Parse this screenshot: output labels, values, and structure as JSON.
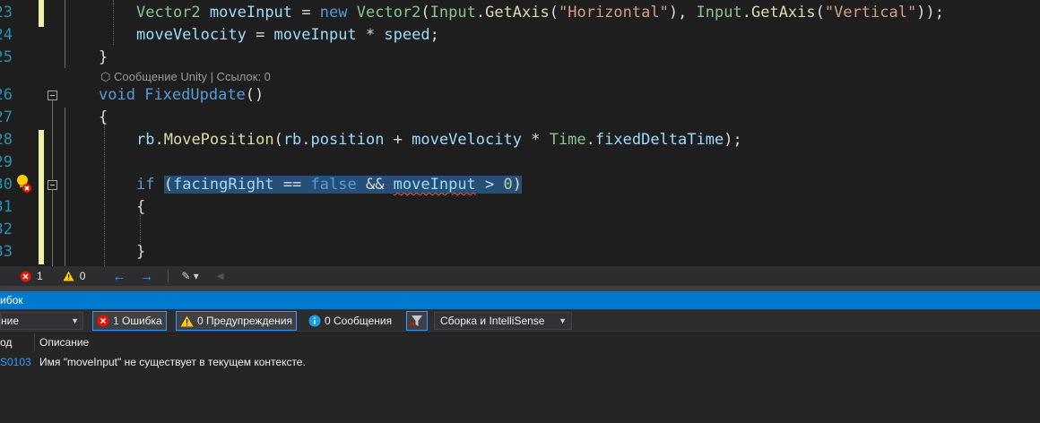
{
  "editor": {
    "line_numbers": [
      "23",
      "24",
      "25",
      "26",
      "27",
      "28",
      "29",
      "30",
      "31",
      "32",
      "33"
    ],
    "codelens": {
      "label": "Сообщение Unity | Ссылок: 0"
    },
    "lines": {
      "l23": {
        "type": "Vector2",
        "var": "moveInput",
        "eq": "=",
        "kw_new": "new",
        "ctor": "Vector2",
        "p1": "(",
        "cls1": "Input",
        "dot1": ".",
        "mt1": "GetAxis",
        "p2": "(",
        "s1": "\"Horizontal\"",
        "p3": "), ",
        "cls2": "Input",
        "dot2": ".",
        "mt2": "GetAxis",
        "p4": "(",
        "s2": "\"Vertical\"",
        "p5": "));"
      },
      "l24": {
        "var1": "moveVelocity",
        "op": " = ",
        "var2": "moveInput",
        "op2": " * ",
        "var3": "speed",
        "end": ";"
      },
      "l25": {
        "brace": "}"
      },
      "l26": {
        "kw": "void",
        "name": "FixedUpdate",
        "paren": "()"
      },
      "l27": {
        "brace": "{"
      },
      "l28": {
        "var1": "rb",
        "dot": ".",
        "mt": "MovePosition",
        "p1": "(",
        "var2": "rb",
        "dot2": ".",
        "var3": "position",
        "op": " + ",
        "var4": "moveVelocity",
        "op2": " * ",
        "cls": "Time",
        "dot3": ".",
        "var5": "fixedDeltaTime",
        "end": ");"
      },
      "l30": {
        "kw": "if",
        "sp": " ",
        "p1": "(",
        "var1": "facingRight",
        "op": " == ",
        "kw2": "false",
        "op2": " && ",
        "var2": "moveInput",
        "op3": " > ",
        "num": "0",
        "p2": ")"
      },
      "l31": {
        "brace": "{"
      },
      "l33": {
        "brace": "}"
      }
    }
  },
  "statusbar": {
    "errors": "1",
    "warnings": "0"
  },
  "panel": {
    "title": "ибок",
    "scope_dropdown": "ние",
    "errors_button": "1 Ошибка",
    "warnings_button": "0 Предупреждения",
    "messages_button": "0 Сообщения",
    "build_dropdown": "Сборка и IntelliSense",
    "columns": {
      "code": "од",
      "description": "Описание"
    },
    "rows": [
      {
        "code": "S0103",
        "description": "Имя \"moveInput\" не существует в текущем контексте."
      }
    ]
  },
  "colors": {
    "accent": "#007acc",
    "error": "#e51400",
    "warning": "#ffcc00",
    "info": "#1ba1e2"
  }
}
